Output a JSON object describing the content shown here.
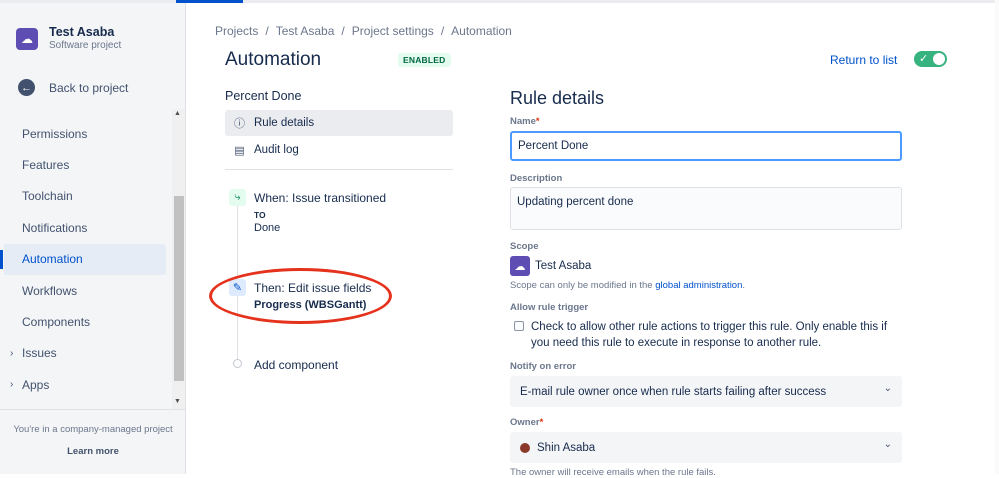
{
  "sidebar": {
    "project_title": "Test Asaba",
    "project_subtitle": "Software project",
    "back_label": "Back to project",
    "items": [
      {
        "label": "Permissions"
      },
      {
        "label": "Features"
      },
      {
        "label": "Toolchain"
      },
      {
        "label": "Notifications"
      },
      {
        "label": "Automation"
      },
      {
        "label": "Workflows"
      },
      {
        "label": "Components"
      },
      {
        "label": "Issues"
      },
      {
        "label": "Apps"
      }
    ],
    "footer_text": "You're in a company-managed project",
    "learn_more": "Learn more"
  },
  "breadcrumb": [
    "Projects",
    "Test Asaba",
    "Project settings",
    "Automation"
  ],
  "header": {
    "title": "Automation",
    "badge": "ENABLED",
    "return_label": "Return to list"
  },
  "rule": {
    "name": "Percent Done",
    "menu": [
      {
        "label": "Rule details",
        "icon": "info-icon"
      },
      {
        "label": "Audit log",
        "icon": "document-icon"
      }
    ],
    "trigger_title": "When: Issue transitioned",
    "trigger_to_label": "TO",
    "trigger_to_value": "Done",
    "action_title": "Then: Edit issue fields",
    "action_subtitle": "Progress (WBSGantt)",
    "add_component": "Add component"
  },
  "details": {
    "title": "Rule details",
    "name_label": "Name",
    "name_value": "Percent Done",
    "description_label": "Description",
    "description_value": "Updating percent done",
    "scope_label": "Scope",
    "scope_value": "Test Asaba",
    "scope_help_prefix": "Scope can only be modified in the ",
    "scope_help_link": "global administration",
    "scope_help_suffix": ".",
    "allow_trigger_label": "Allow rule trigger",
    "allow_trigger_text": "Check to allow other rule actions to trigger this rule. Only enable this if you need this rule to execute in response to another rule.",
    "notify_label": "Notify on error",
    "notify_value": "E-mail rule owner once when rule starts failing after success",
    "owner_label": "Owner",
    "owner_value": "Shin Asaba",
    "owner_help": "The owner will receive emails when the rule fails."
  },
  "colors": {
    "accent": "#0052cc",
    "enabled_green": "#36b37e",
    "highlight_red": "#e5321c"
  }
}
